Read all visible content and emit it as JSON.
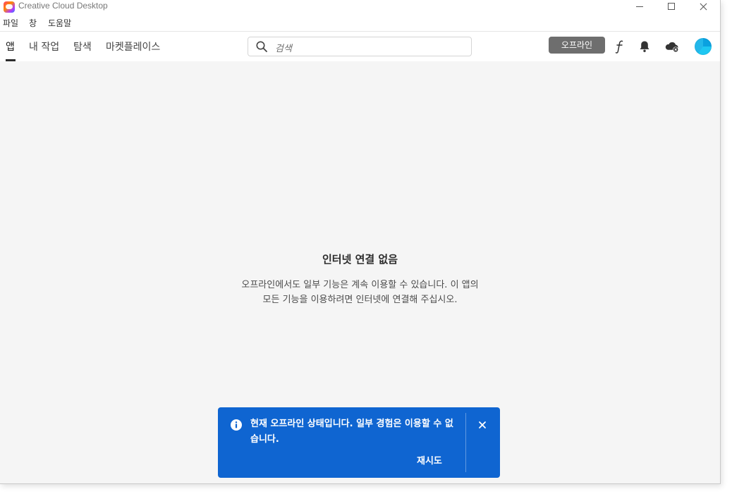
{
  "window": {
    "title": "Creative Cloud Desktop"
  },
  "menu": {
    "file": "파일",
    "window": "창",
    "help": "도움말"
  },
  "nav": {
    "tabs": [
      {
        "label": "앱",
        "active": true
      },
      {
        "label": "내 작업"
      },
      {
        "label": "탐색"
      },
      {
        "label": "마켓플레이스"
      }
    ]
  },
  "search": {
    "placeholder": "검색",
    "icon": "search-icon"
  },
  "status": {
    "offline_label": "오프라인"
  },
  "header_icons": [
    "fonts-icon",
    "bell-icon",
    "cloud-offline-icon",
    "avatar"
  ],
  "empty_state": {
    "title": "인터넷 연결 없음",
    "line1": "오프라인에서도 일부 기능은 계속 이용할 수 있습니다. 이 앱의",
    "line2": "모든 기능을 이용하려면 인터넷에 연결해 주십시오."
  },
  "toast": {
    "message": "현재 오프라인 상태입니다. 일부 경험은 이용할 수 없습니다.",
    "action": "재시도",
    "icon": "info-icon",
    "color": "#0f65d1"
  },
  "colors": {
    "accent": "#0f65d1",
    "badge": "#6e6e6e",
    "content_bg": "#f5f5f5"
  }
}
